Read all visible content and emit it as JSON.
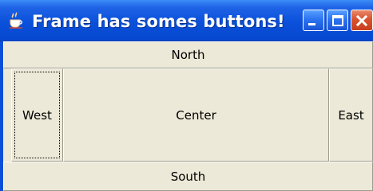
{
  "window": {
    "title": "Frame has somes buttons!",
    "app_icon": "java-cup-icon",
    "controls": [
      "minimize-icon",
      "maximize-icon",
      "close-icon"
    ]
  },
  "layout": {
    "north_label": "North",
    "west_label": "West",
    "center_label": "Center",
    "east_label": "East",
    "south_label": "South"
  },
  "colors": {
    "titlebar": "#0a50da",
    "client_bg": "#ece9d8",
    "close_button": "#d9532f"
  }
}
